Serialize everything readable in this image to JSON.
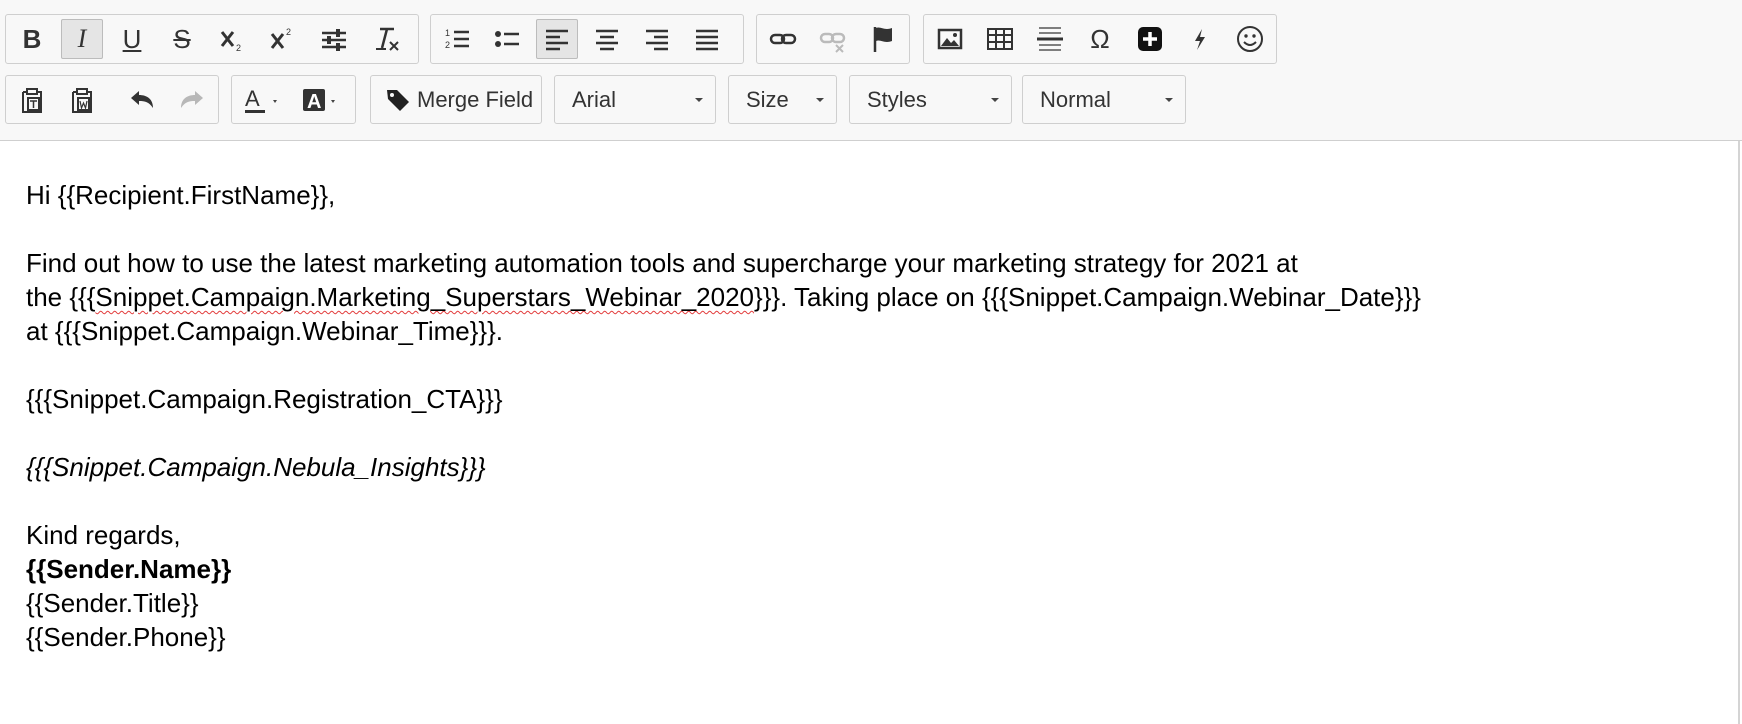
{
  "toolbar": {
    "row1": {
      "bold_label": "B",
      "italic_label": "I",
      "underline_label": "U",
      "strike_label": "S",
      "omega_label": "Ω"
    },
    "row2": {
      "merge_field_label": "Merge Field",
      "font_select": "Arial",
      "size_select": "Size",
      "styles_select": "Styles",
      "format_select": "Normal"
    }
  },
  "content": {
    "greeting": "Hi {{Recipient.FirstName}},",
    "para1_line1": "Find out how to use the latest marketing automation tools and supercharge your marketing strategy for 2021 at",
    "para1_the": "the {{{",
    "para1_snippet": "Snippet.Campaign.Marketing_Superstars_Webinar_2020",
    "para1_rest": "}}}. Taking place on {{{Snippet.Campaign.Webinar_Date}}}",
    "para1_line3": "at {{{Snippet.Campaign.Webinar_Time}}}.",
    "cta": "{{{Snippet.Campaign.Registration_CTA}}}",
    "insights": "{{{Snippet.Campaign.Nebula_Insights}}}",
    "regards": "Kind regards,",
    "sender_name": "{{Sender.Name}}",
    "sender_title": "{{Sender.Title}}",
    "sender_phone": "{{Sender.Phone}}"
  }
}
